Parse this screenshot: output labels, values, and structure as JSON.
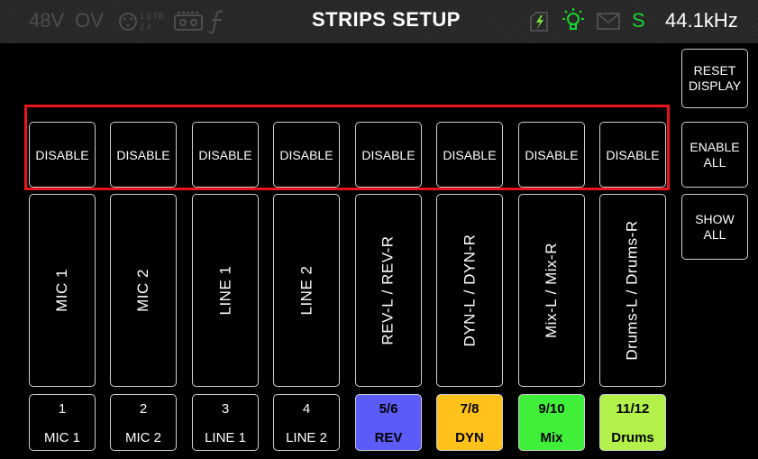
{
  "status_bar": {
    "phantom_48v": "48V",
    "ov": "OV",
    "title": "STRIPS SETUP",
    "s_indicator": "S",
    "sample_rate": "44.1kHz",
    "icons": [
      "xlr-routing-icon",
      "tape-icon",
      "f-icon",
      "flash-card-icon",
      "lightbulb-icon",
      "mail-icon"
    ]
  },
  "side_buttons": {
    "reset_display": "RESET DISPLAY",
    "enable_all": "ENABLE ALL",
    "show_all": "SHOW ALL"
  },
  "disable_label": "DISABLE",
  "strips": [
    {
      "strip_label": "MIC 1",
      "num": "1",
      "name": "MIC 1",
      "color": ""
    },
    {
      "strip_label": "MIC 2",
      "num": "2",
      "name": "MIC 2",
      "color": ""
    },
    {
      "strip_label": "LINE 1",
      "num": "3",
      "name": "LINE 1",
      "color": ""
    },
    {
      "strip_label": "LINE 2",
      "num": "4",
      "name": "LINE 2",
      "color": ""
    },
    {
      "strip_label": "REV-L / REV-R",
      "num": "5/6",
      "name": "REV",
      "color": "#5b5bf7"
    },
    {
      "strip_label": "DYN-L / DYN-R",
      "num": "7/8",
      "name": "DYN",
      "color": "#ffc21a"
    },
    {
      "strip_label": "Mix-L / Mix-R",
      "num": "9/10",
      "name": "Mix",
      "color": "#3fef3a"
    },
    {
      "strip_label": "Drums-L / Drums-R",
      "num": "11/12",
      "name": "Drums",
      "color": "#b2f24a"
    }
  ],
  "colors": {
    "highlight": "#e8141b",
    "status_green": "#18d430",
    "flash_icon": "#7be03b"
  }
}
